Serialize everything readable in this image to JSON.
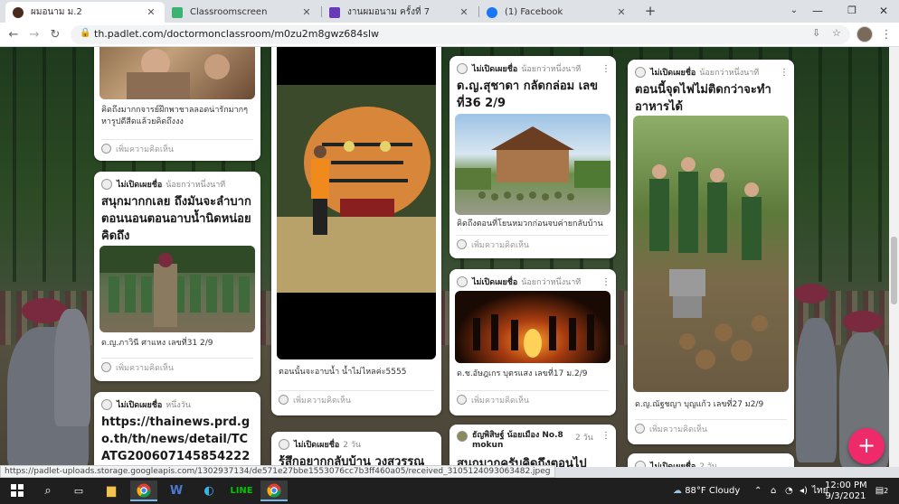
{
  "browser": {
    "tabs": [
      {
        "label": "ผมอนาม ม.2",
        "active": true,
        "favicon_color": "#4a2a1a"
      },
      {
        "label": "Classroomscreen",
        "active": false,
        "favicon_color": "#3cb371"
      },
      {
        "label": "งานผมอนาม ครั้งที่ 7",
        "active": false,
        "favicon_color": "#673ab7"
      },
      {
        "label": "(1) Facebook",
        "active": false,
        "favicon_color": "#1877f2"
      }
    ],
    "url": "th.padlet.com/doctormonclassroom/m0zu2m8gwz684slw",
    "status_url": "https://padlet-uploads.storage.googleapis.com/1302937134/de571e27bbe1553076cc7b3ff460a05/received_3105124093063482.jpeg"
  },
  "cards": [
    {
      "id": "c1",
      "text": "คิดถึงมากกจารย์ฝึกพาชาลลอดน่ารักมากๆหารูปดีสีดแล้วยคิดถึงงง",
      "comment": "เพิ่มความคิดเห็น"
    },
    {
      "id": "c2",
      "author": "ไม่เปิดเผยชื่อ",
      "time": "น้อยกว่าหนึ่งนาที",
      "title": "สนุกมากกเลย ถึงมันจะลำบาก ตอนนอนตอนอาบน้ำนิดหน่อย คิดถึง",
      "text": "ด.ญ.ภาวินี  ศาแหง เลขที่31 2/9",
      "comment": "เพิ่มความคิดเห็น"
    },
    {
      "id": "c3",
      "author": "ไม่เปิดเผยชื่อ",
      "time": "หนึ่งวัน",
      "title": "https://thainews.prd.go.th/th/news/detail/TCATG200607145854222"
    },
    {
      "id": "c4",
      "text": "ตอนนั้นจะอาบน้ำ น้ำไม่ไหลค่ะ5555",
      "comment": "เพิ่มความคิดเห็น"
    },
    {
      "id": "c5",
      "author": "ไม่เปิดเผยชื่อ",
      "time": "2 วัน",
      "title": "รู้สึกอยากกลับบ้าน วงสวรรณ"
    },
    {
      "id": "c6",
      "author": "ไม่เปิดเผยชื่อ",
      "time": "น้อยกว่าหนึ่งนาที",
      "title": "ด.ญ.สุชาดา กลัดกล่อม เลขที่36 2/9",
      "text": "คิดถึงตอนที่โยนหมวกก่อนจบค่ายกลับบ้าน",
      "comment": "เพิ่มความคิดเห็น"
    },
    {
      "id": "c7",
      "author": "ไม่เปิดเผยชื่อ",
      "time": "น้อยกว่าหนึ่งนาที",
      "text": "ด.ช.อัษฎเกร บุตรแสง เลขที่17 ม.2/9",
      "comment": "เพิ่มความคิดเห็น"
    },
    {
      "id": "c8",
      "author": "ธัญพิสิษฐ์ น้อยเมือง No.8 mokun",
      "time": "2 วัน",
      "title": "สนุกมากครับคิดถึงตอนไป"
    },
    {
      "id": "c9",
      "author": "ไม่เปิดเผยชื่อ",
      "time": "น้อยกว่าหนึ่งนาที",
      "title": "ตอนนี้จุดไฟไม่ติดกว่าจะทำอาหารได้",
      "text": "ด.ญ.ณัฐชญา บุญแก้ว เลขที่27 ม2/9",
      "comment": "เพิ่มความคิดเห็น"
    },
    {
      "id": "c10",
      "author": "ไม่เปิดเผยชื่อ",
      "time": "2 วัน"
    }
  ],
  "fab_label": "+",
  "taskbar": {
    "weather": "88°F  Cloudy",
    "language": "ไทย",
    "time": "12:00 PM",
    "date": "9/3/2021",
    "notifications": "2"
  },
  "colors": {
    "accent": "#ee2a6b",
    "taskbar": "#1f1f1f"
  }
}
